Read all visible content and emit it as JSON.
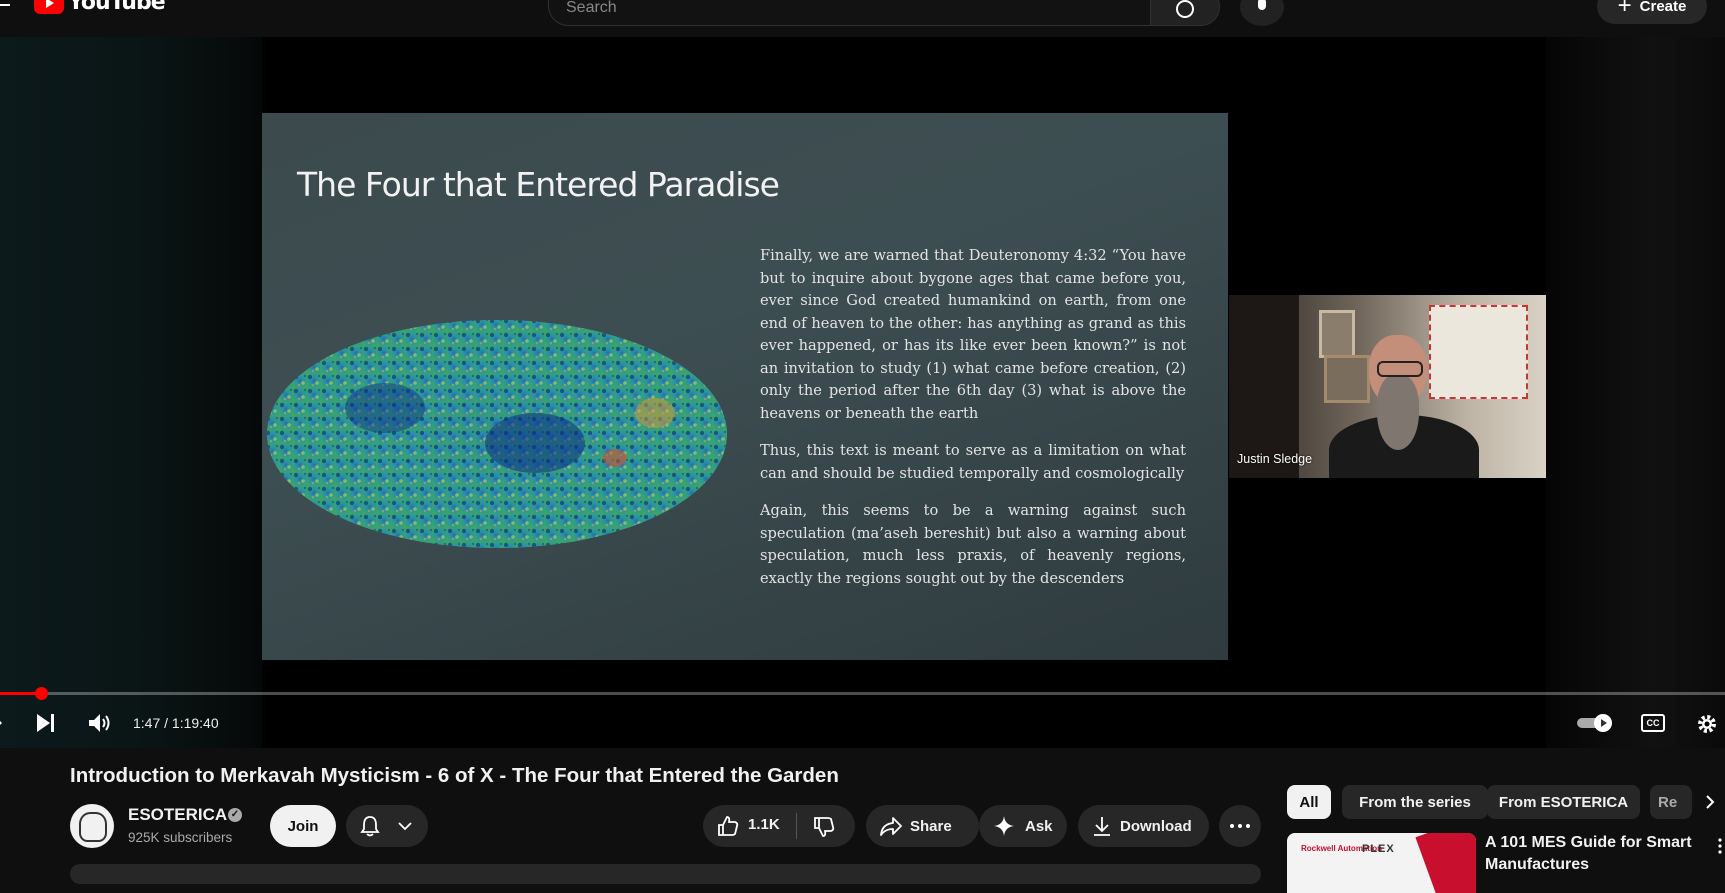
{
  "masthead": {
    "logo_text": "YouTube",
    "search_placeholder": "Search",
    "create_label": "Create"
  },
  "player": {
    "slide": {
      "title": "The Four that Entered Paradise",
      "paragraphs": [
        "Finally, we are warned that Deuteronomy 4:32 “You have but to inquire about bygone ages that came before you, ever since God created humankind on earth, from one end of heaven to the other: has anything as grand as this ever happened, or has its like ever been known?” is not an invitation to study (1) what came before creation, (2) only the period after the 6th day (3) what is above the heavens or beneath the earth",
        "Thus, this text is meant to serve as a limitation on what can and should be studied temporally and cosmologically",
        "Again, this seems to be a warning against such speculation (ma’aseh bereshit) but also a warning about speculation, much less praxis, of heavenly regions, exactly the regions sought out by the descenders"
      ]
    },
    "webcam_name": "Justin Sledge",
    "time_display": "1:47 / 1:19:40",
    "progress_fraction": 0.0224,
    "cc_label": "CC"
  },
  "video": {
    "title": "Introduction to Merkavah Mysticism - 6 of X - The Four that Entered the Garden",
    "channel_name": "ESOTERICA",
    "subscribers": "925K subscribers",
    "join_label": "Join",
    "like_count": "1.1K",
    "share_label": "Share",
    "ask_label": "Ask",
    "download_label": "Download"
  },
  "sidebar": {
    "chips": [
      "All",
      "From the series",
      "From ESOTERICA",
      "Re"
    ],
    "recommendation": {
      "title": "A 101 MES Guide for Smart Manufactures",
      "thumb_brand": "Rockwell Automation",
      "thumb_brand2": "PLEX"
    }
  },
  "colors": {
    "background": "#0f0f0f",
    "accent_red": "#ff0000",
    "chip_bg": "#272727"
  }
}
